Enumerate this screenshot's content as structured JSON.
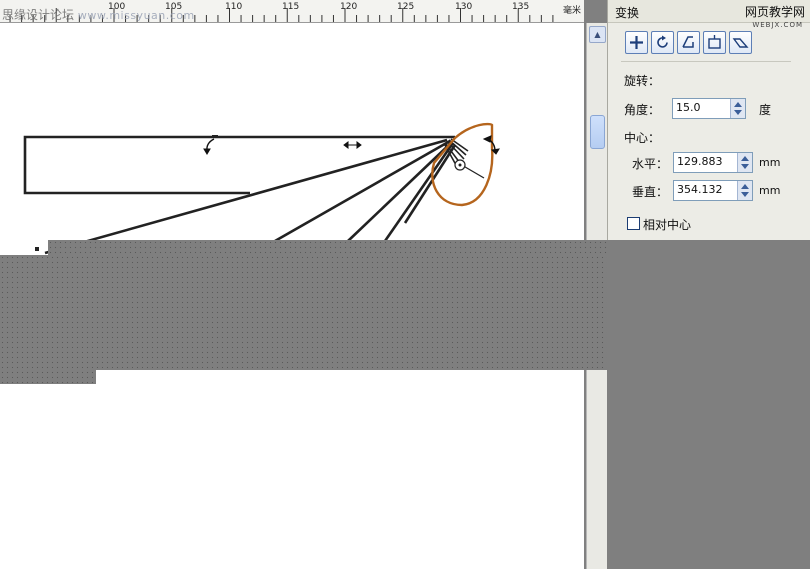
{
  "ruler": {
    "labels": [
      "100",
      "105",
      "110",
      "115",
      "120",
      "125",
      "130",
      "135"
    ],
    "unit": "毫米"
  },
  "watermarks": {
    "left_cn": "思缘设计论坛",
    "left_en": "www.missyuan.com",
    "right_cn": "网页教学网",
    "right_en": "WEBJX.COM"
  },
  "docker": {
    "title": "变换",
    "toolbar_icons": [
      "position-icon",
      "rotate-icon",
      "scale-mirror-icon",
      "size-icon",
      "skew-icon"
    ],
    "rotation_label": "旋转：",
    "angle_label": "角度：",
    "angle_value": "15.0",
    "angle_unit": "度",
    "center_label": "中心：",
    "horizontal_label": "水平：",
    "horizontal_value": "129.883",
    "vertical_label": "垂直：",
    "vertical_value": "354.132",
    "length_unit": "mm",
    "relative_center_label": "相对中心"
  },
  "colors": {
    "outline": "#222222",
    "selected_shape": "#b5651d",
    "occlusion": "#7f7f7f"
  }
}
